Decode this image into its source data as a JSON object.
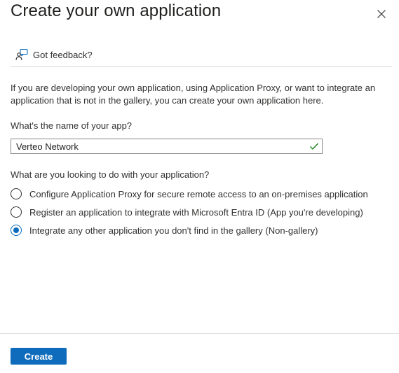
{
  "header": {
    "title": "Create your own application",
    "close_icon": "close-icon"
  },
  "feedback": {
    "icon": "feedback-icon",
    "label": "Got feedback?"
  },
  "description": "If you are developing your own application, using Application Proxy, or want to integrate an application that is not in the gallery, you can create your own application here.",
  "app_name": {
    "label": "What's the name of your app?",
    "value": "Verteo Network",
    "valid": true
  },
  "purpose": {
    "label": "What are you looking to do with your application?",
    "options": [
      {
        "label": "Configure Application Proxy for secure remote access to an on-premises application",
        "selected": false
      },
      {
        "label": "Register an application to integrate with Microsoft Entra ID (App you're developing)",
        "selected": false
      },
      {
        "label": "Integrate any other application you don't find in the gallery (Non-gallery)",
        "selected": true
      }
    ]
  },
  "footer": {
    "create_label": "Create"
  },
  "colors": {
    "accent": "#0f6cbd",
    "valid_check": "#107c10"
  }
}
